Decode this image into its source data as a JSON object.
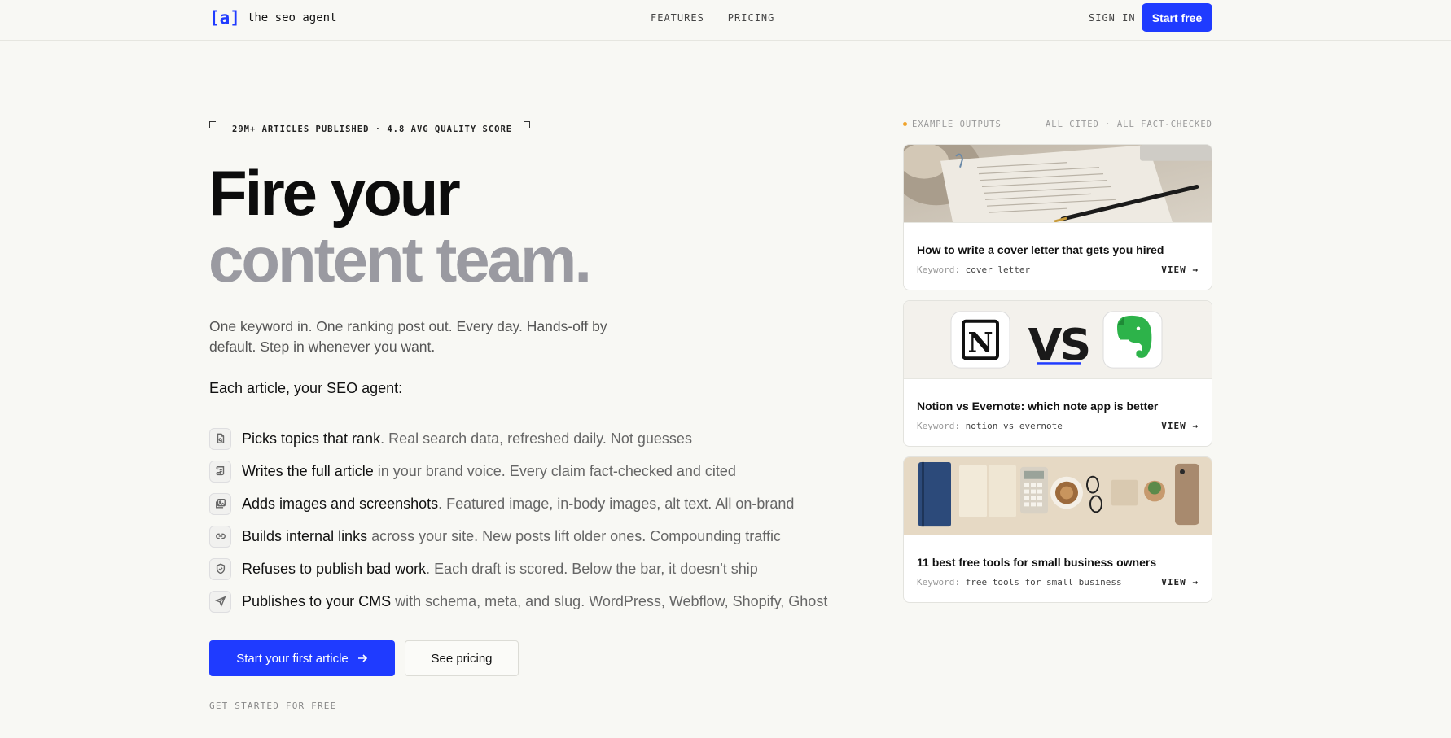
{
  "nav": {
    "logo_mark": "[a]",
    "logo_text": "the seo agent",
    "links": [
      "FEATURES",
      "PRICING"
    ],
    "sign_in": "SIGN IN",
    "start_free": "Start free"
  },
  "hero": {
    "badge": "29M+ ARTICLES PUBLISHED · 4.8 AVG QUALITY SCORE",
    "headline_1": "Fire your",
    "headline_2": "content team.",
    "subtitle": "One keyword in. One ranking post out. Every day. Hands-off by default. Step in whenever you want.",
    "each_label": "Each article, your SEO agent:",
    "features": [
      {
        "icon": "document-search-icon",
        "bold": "Picks topics that rank",
        "rest": ". Real search data, refreshed daily. Not guesses"
      },
      {
        "icon": "scroll-icon",
        "bold": "Writes the full article",
        "rest": " in your brand voice. Every claim fact-checked and cited"
      },
      {
        "icon": "images-icon",
        "bold": "Adds images and screenshots",
        "rest": ". Featured image, in-body images, alt text. All on-brand"
      },
      {
        "icon": "link-icon",
        "bold": "Builds internal links",
        "rest": " across your site. New posts lift older ones. Compounding traffic"
      },
      {
        "icon": "shield-check-icon",
        "bold": "Refuses to publish bad work",
        "rest": ". Each draft is scored. Below the bar, it doesn't ship"
      },
      {
        "icon": "send-icon",
        "bold": "Publishes to your CMS",
        "rest": " with schema, meta, and slug. WordPress, Webflow, Shopify, Ghost"
      }
    ],
    "cta_primary": "Start your first article",
    "cta_secondary": "See pricing",
    "get_started": "GET STARTED FOR FREE"
  },
  "examples": {
    "label": "EXAMPLE OUTPUTS",
    "note": "ALL CITED · ALL FACT-CHECKED",
    "keyword_label": "Keyword:",
    "view_label": "VIEW",
    "cards": [
      {
        "title": "How to write a cover letter that gets you hired",
        "keyword": "cover letter"
      },
      {
        "title": "Notion vs Evernote: which note app is better",
        "keyword": "notion vs evernote",
        "vs_text": "VS",
        "notion_letter": "N"
      },
      {
        "title": "11 best free tools for small business owners",
        "keyword": "free tools for small business"
      }
    ]
  },
  "colors": {
    "accent": "#1f3bff",
    "background": "#f8f8f4",
    "headline_muted": "#9a9aa1",
    "status_dot": "#f0a32a"
  }
}
